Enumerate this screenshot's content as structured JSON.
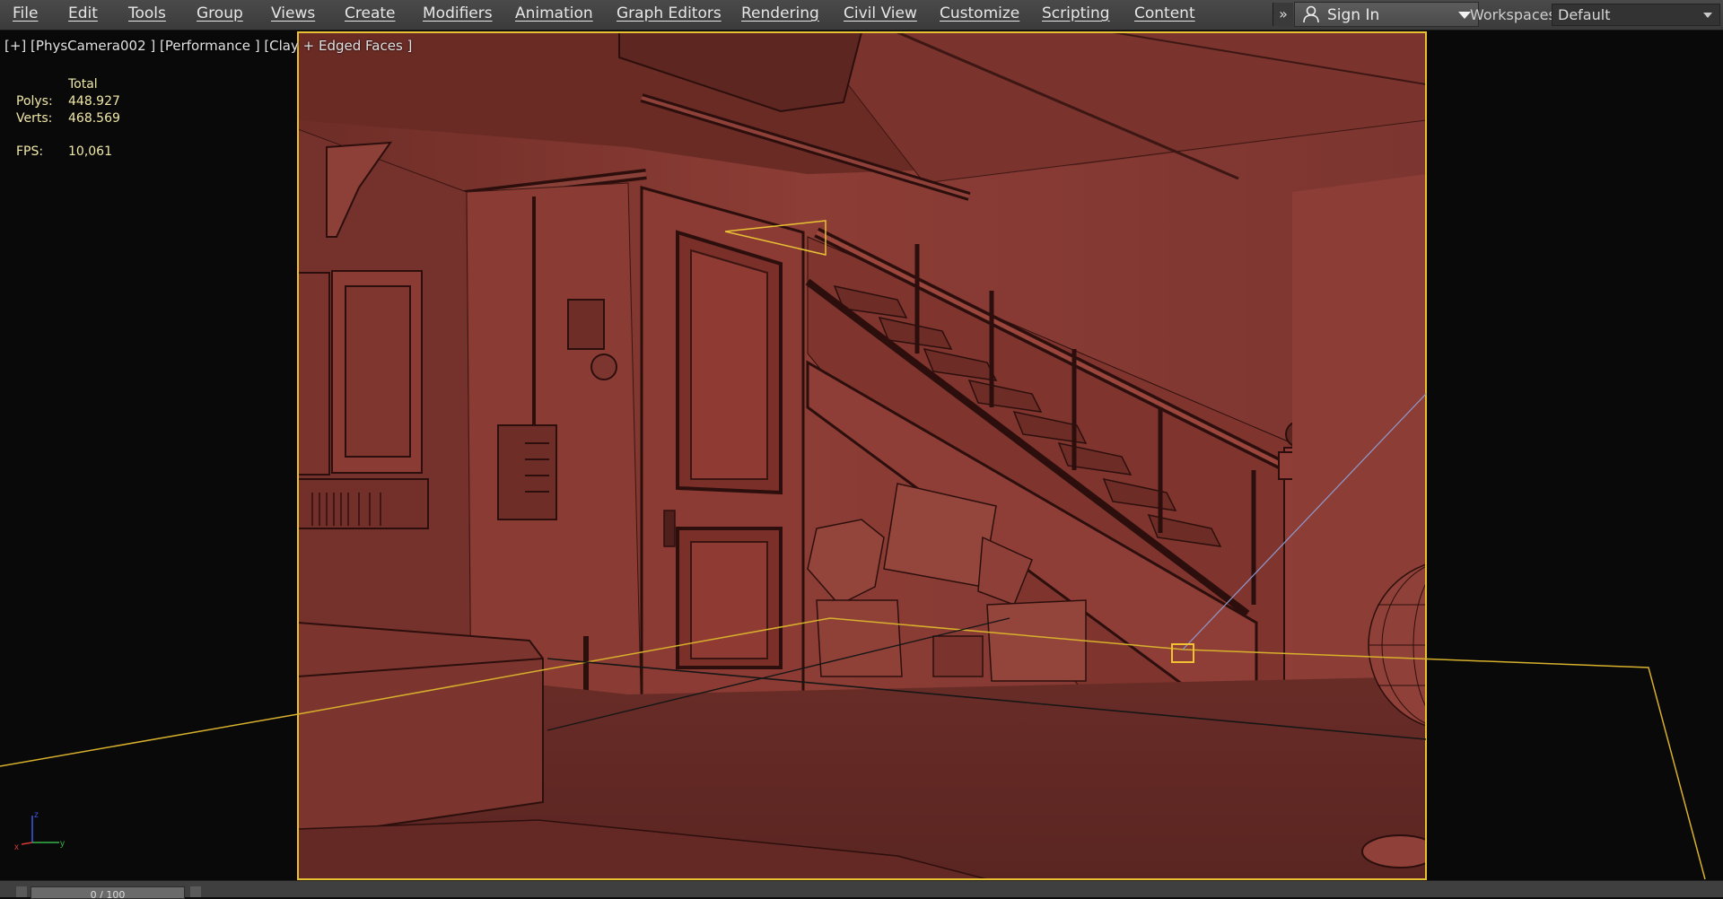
{
  "menu": {
    "items": [
      "File",
      "Edit",
      "Tools",
      "Group",
      "Views",
      "Create",
      "Modifiers",
      "Animation",
      "Graph Editors",
      "Rendering",
      "Civil View",
      "Customize",
      "Scripting",
      "Content"
    ],
    "more_glyph": "»",
    "sign_in_label": "Sign In",
    "workspaces_label": "Workspaces:",
    "workspace_value": "Default"
  },
  "viewport": {
    "label": "[+] [PhysCamera002 ] [Performance ] [Clay + Edged Faces ]",
    "stats": {
      "header": "Total",
      "polys_label": "Polys:",
      "polys_value": "448.927",
      "verts_label": "Verts:",
      "verts_value": "468.569",
      "fps_label": "FPS:",
      "fps_value": "10,061"
    },
    "axis": {
      "x": "x",
      "y": "y",
      "z": "z"
    }
  },
  "timeline": {
    "slider_text": "0 / 100"
  },
  "icons": {
    "user": "user-icon",
    "dropdown": "chevron-down-icon",
    "more": "double-chevron-right-icon",
    "axis": "axis-tripod-icon"
  },
  "colors": {
    "clay": "#8c3d35",
    "clay_dark": "#6f2e28",
    "safe_frame": "#e8c234",
    "selection": "#f2c232",
    "stats_text": "#f1e9a8"
  }
}
